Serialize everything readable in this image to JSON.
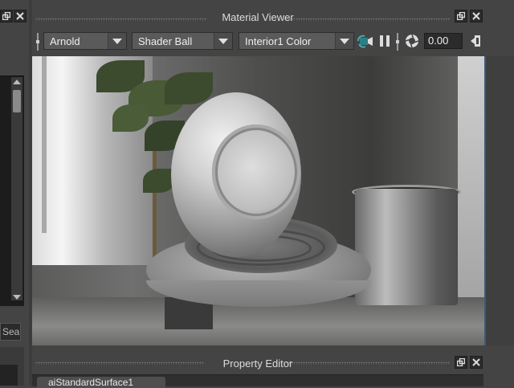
{
  "material_viewer": {
    "title": "Material Viewer",
    "renderer": "Arnold",
    "geometry": "Shader Ball",
    "environment": "Interior1 Color",
    "exposure": "0.00"
  },
  "left_panel": {
    "search_placeholder": "Sea"
  },
  "property_editor": {
    "title": "Property Editor",
    "tab_label": "aiStandardSurface1"
  },
  "colors": {
    "panel_bg": "#444444",
    "field_bg": "#2b2b2b",
    "dropdown_bg": "#5a5a5a",
    "accent_blue": "#3d5a7a",
    "pause_icon": "#dddddd",
    "refresh_icon_teal": "#57a3a3"
  },
  "icons": {
    "float_panel": "float-icon",
    "close_panel": "close-icon",
    "update_camera": "camera-refresh-icon",
    "pause": "pause-icon",
    "render_settings": "aperture-icon",
    "exposure_slider": "slider-icon",
    "gamma_toggle": "gamma-icon"
  }
}
